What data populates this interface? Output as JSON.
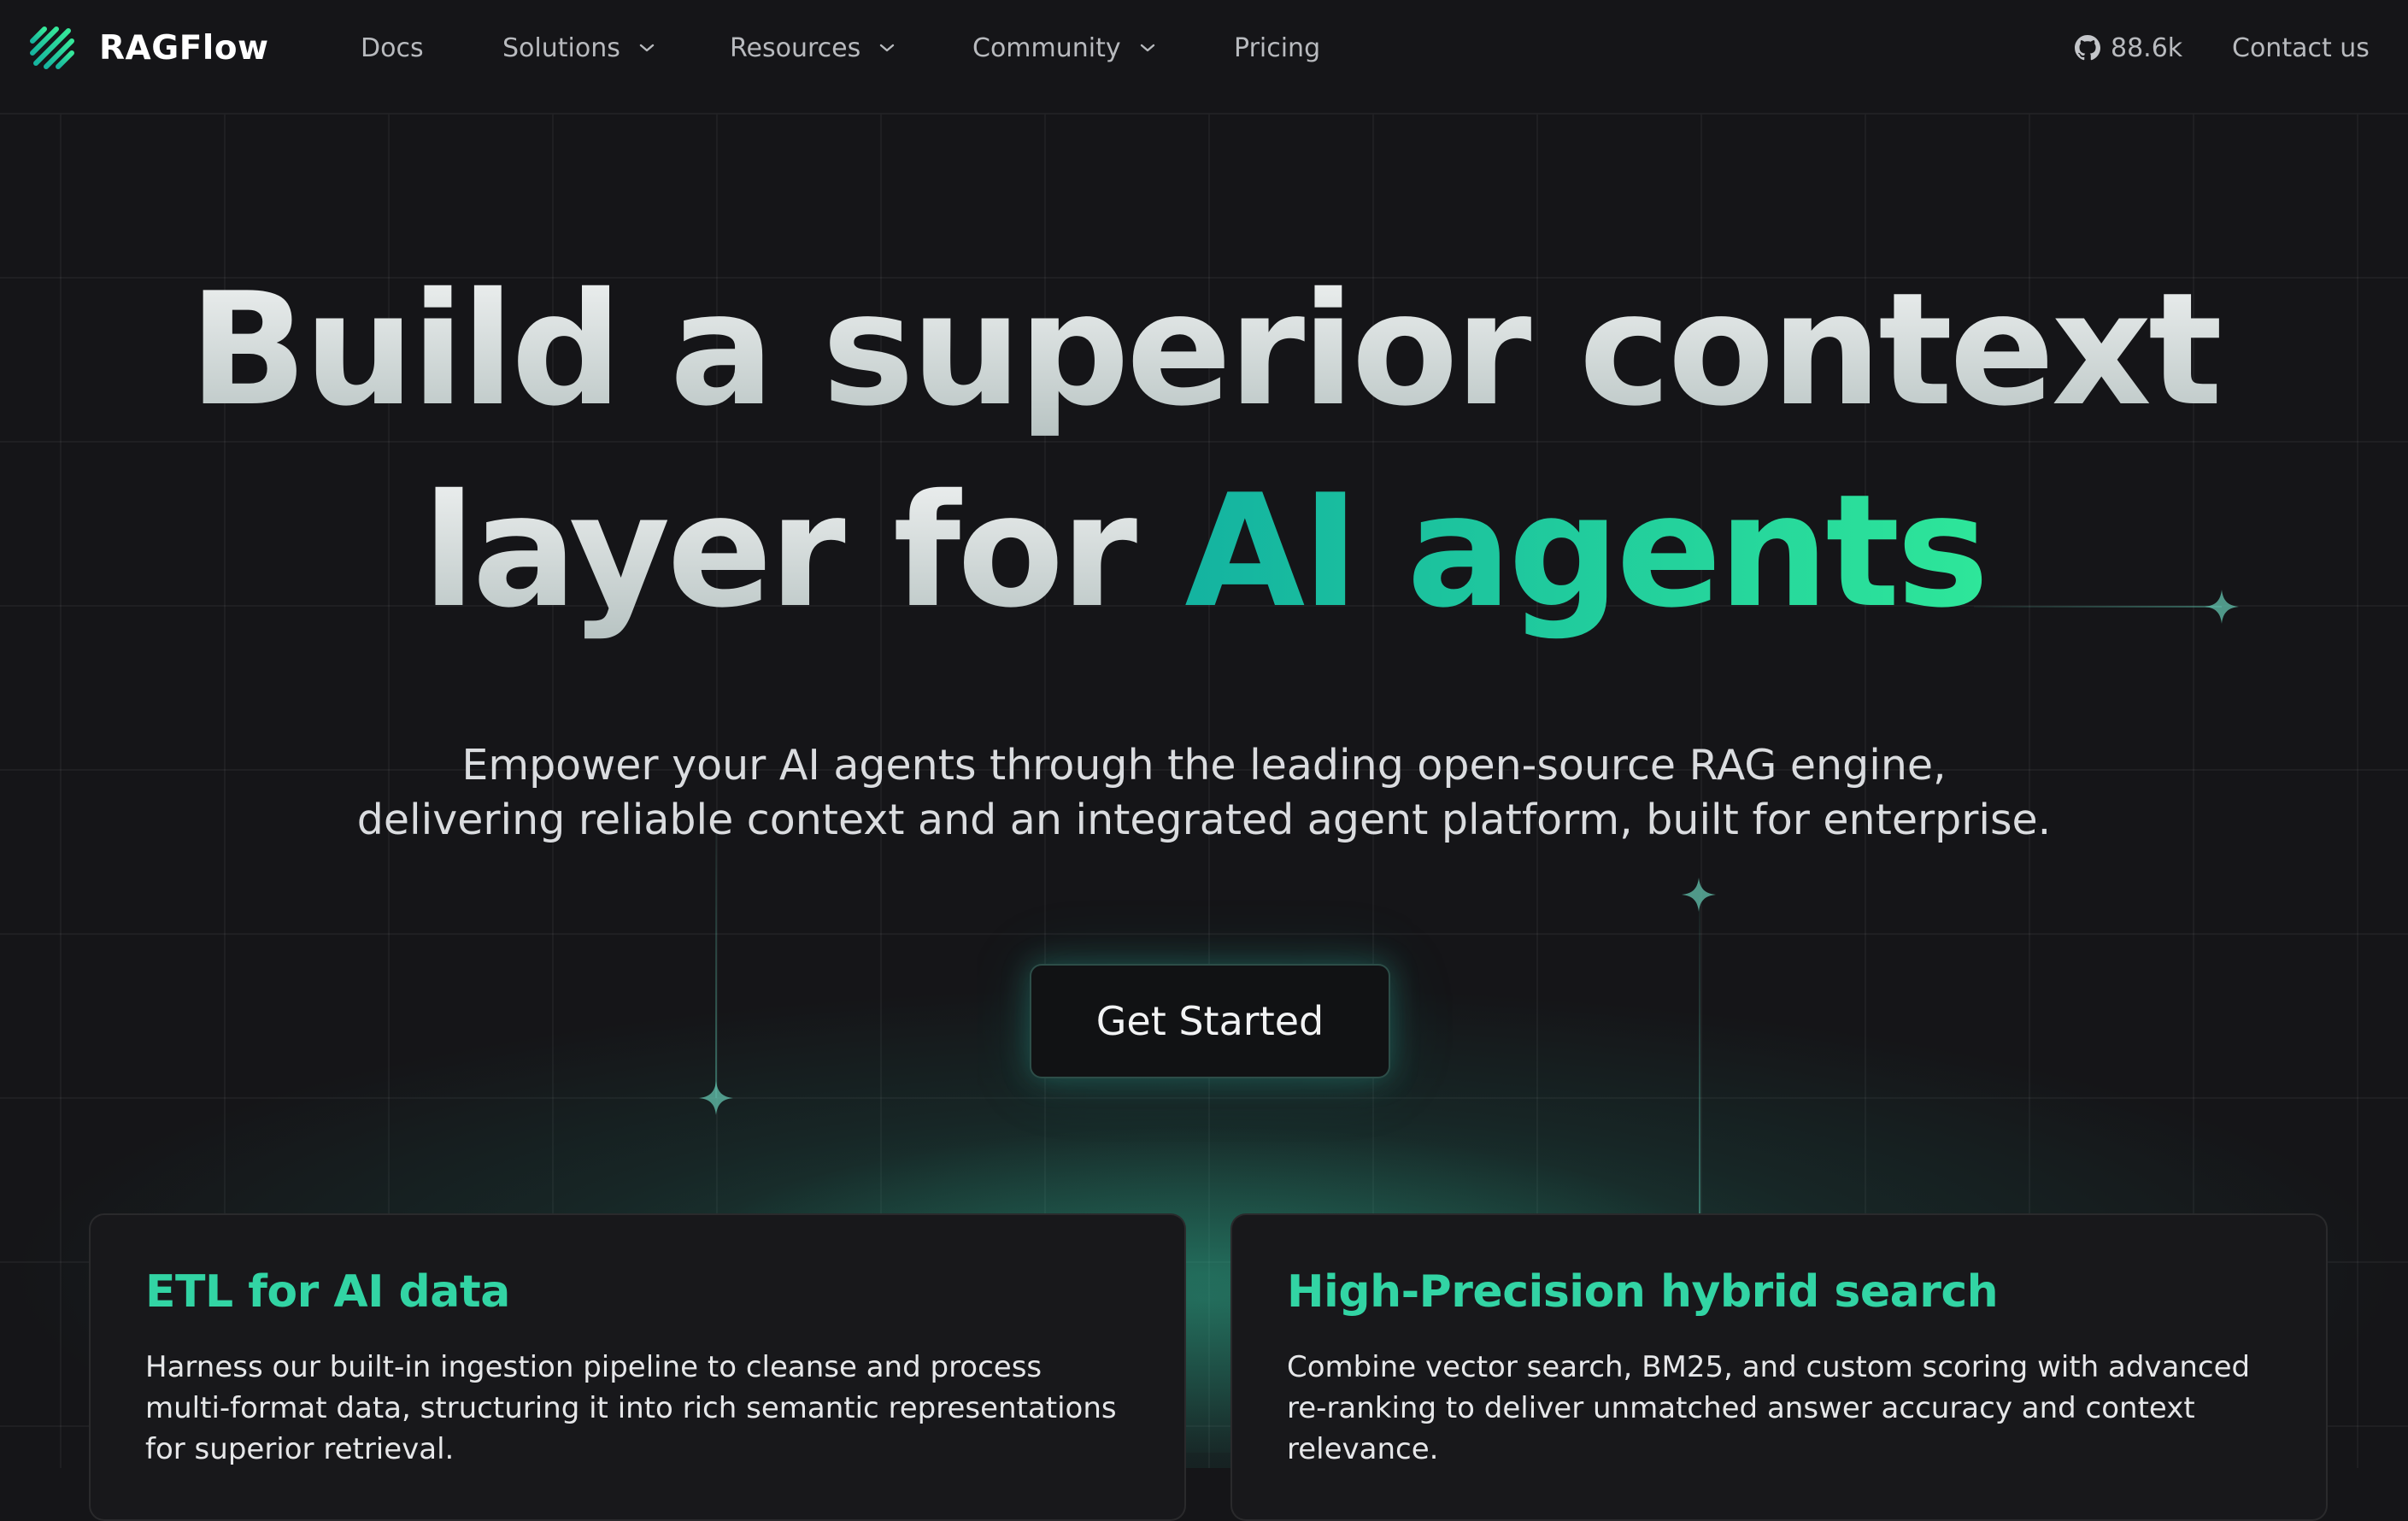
{
  "nav": {
    "brand": "RAGFlow",
    "items": [
      {
        "label": "Docs"
      },
      {
        "label": "Solutions"
      },
      {
        "label": "Resources"
      },
      {
        "label": "Community"
      },
      {
        "label": "Pricing"
      }
    ],
    "github_stars": "88.6k",
    "contact": "Contact us"
  },
  "hero": {
    "title_line1": "Build a superior context",
    "title_line2_plain": "layer for ",
    "title_line2_highlight": "AI agents",
    "subtitle_line1": "Empower your AI agents through the leading open-source RAG engine,",
    "subtitle_line2": "delivering reliable context and an integrated agent platform, built for enterprise.",
    "cta": "Get Started"
  },
  "cards": [
    {
      "title": "ETL for AI data",
      "body": "Harness our built-in ingestion pipeline to cleanse and process multi-format data, structuring it into rich semantic representations for superior retrieval."
    },
    {
      "title": "High-Precision hybrid search",
      "body": "Combine vector search, BM25, and custom scoring with advanced re-ranking to deliver unmatched answer accuracy and context relevance."
    }
  ],
  "colors": {
    "background": "#151518",
    "accent_teal": "#14b3a0",
    "accent_green": "#2ee69a",
    "card_title": "#32d4a4"
  },
  "icons": [
    "ragflow-logo-icon",
    "chevron-down-icon",
    "github-icon",
    "sparkle-icon"
  ]
}
